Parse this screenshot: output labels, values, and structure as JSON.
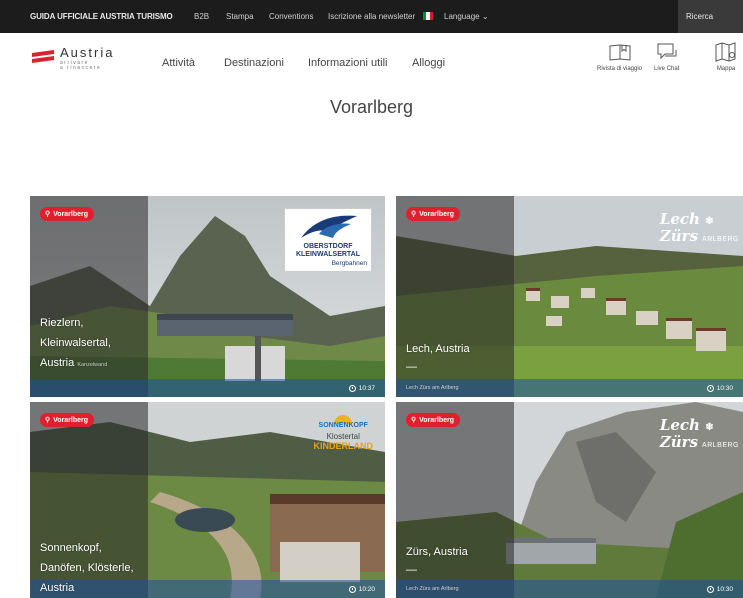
{
  "topbar": {
    "brand": "GUIDA UFFICIALE AUSTRIA TURISMO",
    "links": [
      "B2B",
      "Stampa",
      "Conventions",
      "Iscrizione alla newsletter"
    ],
    "language": "Language",
    "search": "Ricerca",
    "flag_colors": [
      "#008c45",
      "#f4f5f0",
      "#cd212a"
    ]
  },
  "header": {
    "logo_word": "Austria",
    "logo_sub1": "arrivare",
    "logo_sub2": "a rinascere",
    "logo_color": "#e0202e",
    "nav": [
      "Attività",
      "Destinazioni",
      "Informazioni utili",
      "Alloggi"
    ],
    "tools": [
      {
        "label": "Rivista di viaggio",
        "icon": "book-icon"
      },
      {
        "label": "Live Chat",
        "icon": "chat-icon"
      },
      {
        "label": "Mappa",
        "icon": "map-icon"
      }
    ]
  },
  "page_title": "Vorarlberg",
  "cards": [
    {
      "badge": "Vorarlberg",
      "name_lines": [
        "Riezlern,",
        "Kleinwalsertal,",
        "Austria"
      ],
      "subtitle": "Kanzelwand",
      "time": "10:37"
    },
    {
      "badge": "Vorarlberg",
      "name_lines": [
        "Lech, Austria"
      ],
      "subtitle": "Lech Zürs am Arlberg",
      "time": "10:30"
    },
    {
      "badge": "Vorarlberg",
      "name_lines": [
        "Sonnenkopf,",
        "Danöfen, Klösterle,",
        "Austria"
      ],
      "subtitle": "",
      "time": "10:20"
    },
    {
      "badge": "Vorarlberg",
      "name_lines": [
        "Zürs, Austria"
      ],
      "subtitle": "Lech Zürs am Arlberg",
      "time": "10:30"
    }
  ],
  "logos": {
    "oks_line1": "OBERSTDORF",
    "oks_line2": "KLEINWALSERTAL",
    "oks_line3": "Bergbahnen",
    "lz_word1": "Lech",
    "lz_word2": "Zürs",
    "lz_arlberg": "ARLBERG",
    "sonnen_line1": "SONNENKOPF",
    "sonnen_line2": "Klostertal",
    "sonnen_line3": "KINDERLAND"
  }
}
